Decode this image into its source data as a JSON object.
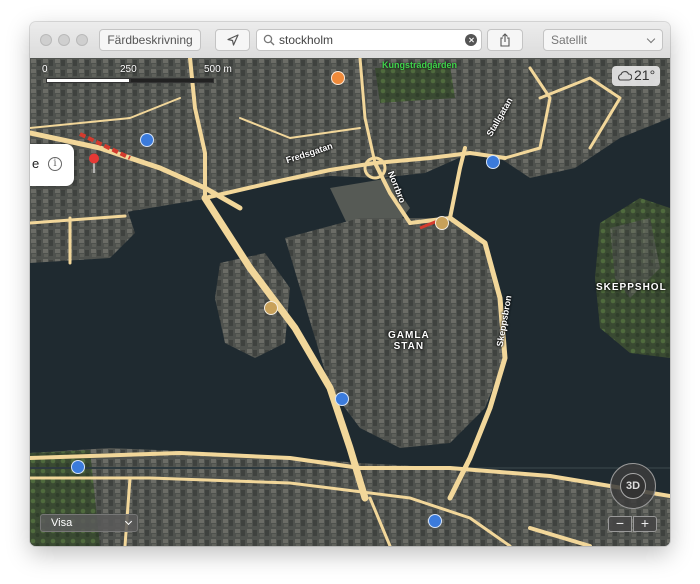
{
  "toolbar": {
    "directions_label": "Färdbeskrivning",
    "location_icon": "location-arrow-icon",
    "search_value": "stockholm",
    "share_icon": "share-icon",
    "map_type_selected": "Satellit"
  },
  "map": {
    "scale": {
      "zero": "0",
      "mid": "250",
      "max": "500 m"
    },
    "weather": {
      "icon": "cloud-icon",
      "temperature": "21°"
    },
    "callout": {
      "text": "e",
      "info_icon": "info-icon"
    },
    "place_labels": {
      "kungstradgarden": "Kungsträdgården",
      "fredsgatan": "Fredsgatan",
      "norrbro": "Norrbro",
      "stallgatan": "Stallgatan",
      "skeppsbron": "Skeppsbron",
      "gamla_stan": "GAMLA\nSTAN",
      "skeppsholmen": "SKEPPSHOL"
    },
    "visa_label": "Visa",
    "compass_label": "3D",
    "zoom_out": "−",
    "zoom_in": "+"
  },
  "colors": {
    "water": "#1f2a30",
    "land": "#4a4d48",
    "road": "#f2d79a",
    "pin_red": "#e53935",
    "poi_orange": "#f08a3a",
    "poi_blue": "#3b7bdc",
    "poi_tan": "#c8a15a"
  }
}
